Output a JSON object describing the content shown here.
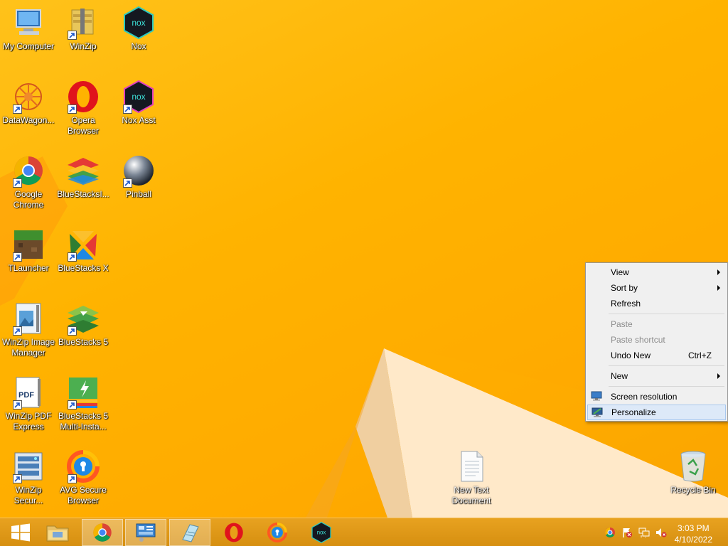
{
  "desktop": {
    "icons": [
      {
        "label": "My Computer",
        "icon": "computer-icon"
      },
      {
        "label": "WinZip",
        "icon": "winzip-icon"
      },
      {
        "label": "Nox",
        "icon": "nox-icon"
      },
      {
        "label": "DataWagon...",
        "icon": "datawagon-icon"
      },
      {
        "label": "Opera Browser",
        "icon": "opera-icon"
      },
      {
        "label": "Nox Asst",
        "icon": "nox-asst-icon"
      },
      {
        "label": "Google Chrome",
        "icon": "chrome-icon"
      },
      {
        "label": "BlueStacksI...",
        "icon": "bluestacks-icon"
      },
      {
        "label": "Pinball",
        "icon": "pinball-icon"
      },
      {
        "label": "TLauncher",
        "icon": "tlauncher-icon"
      },
      {
        "label": "BlueStacks X",
        "icon": "bluestacks-x-icon"
      },
      {
        "label": "WinZip Image Manager",
        "icon": "winzip-image-icon"
      },
      {
        "label": "BlueStacks 5",
        "icon": "bluestacks5-icon"
      },
      {
        "label": "WinZip PDF Express",
        "icon": "winzip-pdf-icon"
      },
      {
        "label": "BlueStacks 5 Multi-Insta...",
        "icon": "bluestacks-multi-icon"
      },
      {
        "label": "WinZip Secur...",
        "icon": "winzip-secure-icon"
      },
      {
        "label": "AVG Secure Browser",
        "icon": "avg-icon"
      },
      {
        "label": "New Text Document",
        "icon": "text-document-icon"
      },
      {
        "label": "Recycle Bin",
        "icon": "recycle-bin-icon"
      }
    ]
  },
  "context_menu": {
    "items": [
      {
        "label": "View",
        "submenu": true,
        "enabled": true
      },
      {
        "label": "Sort by",
        "submenu": true,
        "enabled": true
      },
      {
        "label": "Refresh",
        "enabled": true
      },
      {
        "label": "Paste",
        "enabled": false
      },
      {
        "label": "Paste shortcut",
        "enabled": false
      },
      {
        "label": "Undo New",
        "shortcut": "Ctrl+Z",
        "enabled": true
      },
      {
        "label": "New",
        "submenu": true,
        "enabled": true
      },
      {
        "label": "Screen resolution",
        "enabled": true
      },
      {
        "label": "Personalize",
        "enabled": true,
        "highlighted": true
      }
    ]
  },
  "taskbar": {
    "buttons": [
      {
        "name": "start-button",
        "icon": "windows-logo-icon"
      },
      {
        "name": "file-explorer-button",
        "icon": "folder-icon"
      },
      {
        "name": "chrome-taskbar-button",
        "icon": "chrome-icon",
        "active": true
      },
      {
        "name": "control-panel-taskbar-button",
        "icon": "control-panel-icon",
        "active": true
      },
      {
        "name": "notepad-taskbar-button",
        "icon": "notepad-icon",
        "active": true
      },
      {
        "name": "opera-taskbar-button",
        "icon": "opera-icon"
      },
      {
        "name": "avg-taskbar-button",
        "icon": "avg-icon"
      },
      {
        "name": "nox-taskbar-button",
        "icon": "nox-icon"
      }
    ],
    "clock": {
      "time": "3:03 PM",
      "date": "4/10/2022"
    }
  },
  "colors": {
    "accent": "#ffb300",
    "menu_highlight": "#dde9f8",
    "taskbar": "#e09a18"
  }
}
